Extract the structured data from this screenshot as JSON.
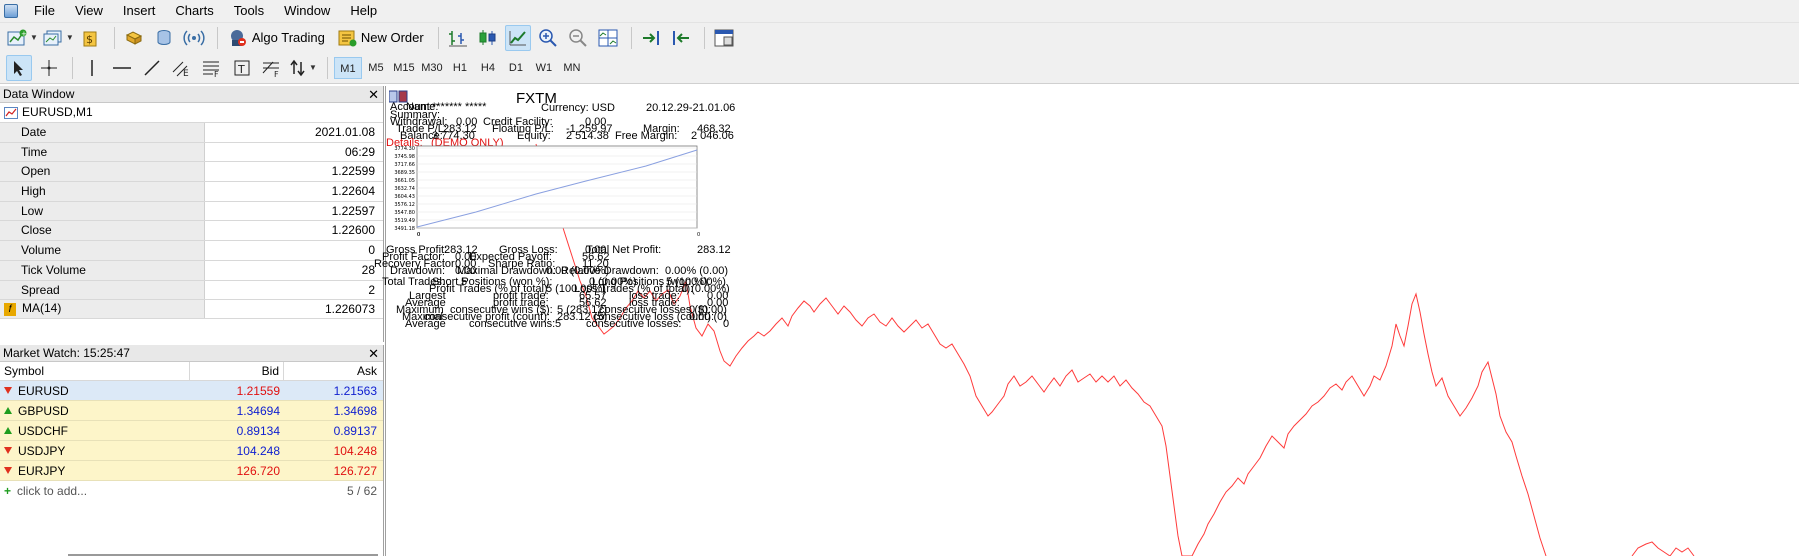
{
  "menu": [
    "File",
    "View",
    "Insert",
    "Charts",
    "Tools",
    "Window",
    "Help"
  ],
  "toolbar": {
    "algo_trading": "Algo Trading",
    "new_order": "New Order"
  },
  "timeframes": [
    "M1",
    "M5",
    "M15",
    "M30",
    "H1",
    "H4",
    "D1",
    "W1",
    "MN"
  ],
  "active_timeframe": "M1",
  "data_window": {
    "title": "Data Window",
    "symbol": "EURUSD,M1",
    "rows": [
      {
        "name": "Date",
        "value": "2021.01.08"
      },
      {
        "name": "Time",
        "value": "06:29"
      },
      {
        "name": "Open",
        "value": "1.22599"
      },
      {
        "name": "High",
        "value": "1.22604"
      },
      {
        "name": "Low",
        "value": "1.22597"
      },
      {
        "name": "Close",
        "value": "1.22600"
      },
      {
        "name": "Volume",
        "value": "0"
      },
      {
        "name": "Tick Volume",
        "value": "28"
      },
      {
        "name": "Spread",
        "value": "2"
      }
    ],
    "indicator": {
      "name": "MA(14)",
      "value": "1.226073"
    }
  },
  "market_watch": {
    "title": "Market Watch: 15:25:47",
    "columns": [
      "Symbol",
      "Bid",
      "Ask"
    ],
    "rows": [
      {
        "symbol": "EURUSD",
        "bid": "1.21559",
        "ask": "1.21563",
        "dir": "down",
        "bid_color": "red",
        "ask_color": "blue"
      },
      {
        "symbol": "GBPUSD",
        "bid": "1.34694",
        "ask": "1.34698",
        "dir": "up",
        "bid_color": "blue",
        "ask_color": "blue"
      },
      {
        "symbol": "USDCHF",
        "bid": "0.89134",
        "ask": "0.89137",
        "dir": "up",
        "bid_color": "blue",
        "ask_color": "blue"
      },
      {
        "symbol": "USDJPY",
        "bid": "104.248",
        "ask": "104.248",
        "dir": "down",
        "bid_color": "blue",
        "ask_color": "red"
      },
      {
        "symbol": "EURJPY",
        "bid": "126.720",
        "ask": "126.727",
        "dir": "down",
        "bid_color": "red",
        "ask_color": "red"
      }
    ],
    "add_label": "click to add...",
    "count": "5 / 62"
  },
  "report": {
    "broker": "FXTM",
    "account_label": "Account:",
    "account_value": "******* *****",
    "currency": "Currency: USD",
    "period": "20.12.29-21.01.06",
    "name_label": "Name:",
    "summary_label": "Summary:",
    "withdrawal_label": "Withdrawal:",
    "withdrawal_value": "0.00",
    "credit_label": "Credit Facility:",
    "credit_value": "0.00",
    "tradepl_label": "Trade P/L:",
    "tradepl_value": "283.12",
    "floating_label": "Floating P/L:",
    "floating_value": "-1 259.97",
    "margin_label": "Margin:",
    "margin_value": "468.32",
    "balance_label": "Balance:",
    "balance_value": "3 774.30",
    "equity_label": "Equity:",
    "equity_value": "2 514.38",
    "free_margin_label": "Free Margin:",
    "free_margin_value": "2 046.06",
    "demo_label": "Details:",
    "demo_note": "(DEMO ONLY)",
    "y_ticks": [
      "3774.30",
      "3745.98",
      "3717.66",
      "3689.35",
      "3661.05",
      "3632.74",
      "3604.43",
      "3576.12",
      "3547.80",
      "3519.49",
      "3491.18"
    ],
    "x_ticks": [
      "0",
      "0",
      "0"
    ],
    "stats": {
      "gross_profit_label": "Gross Profit:",
      "gross_profit": "283.12",
      "gross_loss_label": "Gross Loss:",
      "gross_loss": "0.00",
      "total_net_label": "Total Net Profit:",
      "total_net": "283.12",
      "profit_factor_label": "Profit Factor:",
      "profit_factor": "0.00",
      "expected_payoff_label": "Expected Payoff:",
      "expected_payoff": "56.62",
      "recovery_label": "Recovery Factor:",
      "recovery": "0.00",
      "sharpe_label": "Sharpe Ratio:",
      "sharpe": "11.20",
      "drawdown_label": "Drawdown:",
      "drawdown": "0.00",
      "maximal_dd_label": "Maximal Drawdown:",
      "maximal_dd": "0.00 (0.00%)",
      "relative_dd_label": "Relative Drawdown:",
      "relative_dd": "0.00% (0.00)",
      "total_trades_label": "Total Trades:",
      "total_trades": "5",
      "short_label": "Short Positions (won %):",
      "short": "0 (0.00%)",
      "long_label": "Long Positions (won %):",
      "long": "5 (100.00%)",
      "profit_trades_label": "Profit Trades (% of total):",
      "profit_trades": "5 (100.00%)",
      "loss_trades_label": "Loss Trades (% of total):",
      "loss_trades": "0 (0.00%)",
      "largest_label": "Largest",
      "profit_trade_label": "profit trade:",
      "largest_profit": "65.57",
      "loss_trade_label": "loss trade:",
      "largest_loss": "0.00",
      "average_label": "Average",
      "average_profit": "56.62",
      "average_loss": "0.00",
      "maximum_label": "Maximum",
      "consec_wins_label": "consecutive wins ($):",
      "consec_wins": "5 (283.12)",
      "consec_losses_label": "consecutive losses ($):",
      "consec_losses": "0 (0.00)",
      "maximal_label": "Maximal",
      "consec_profit_label": "consecutive profit (count):",
      "consec_profit": "283.12 (5)",
      "consec_loss_label": "consecutive loss (count):",
      "consec_loss": "0.00 (0)",
      "average2_label": "Average",
      "avg_consec_wins_label": "consecutive wins:",
      "avg_consec_wins": "5",
      "avg_consec_losses_label": "consecutive losses:",
      "avg_consec_losses": "0"
    }
  },
  "colors": {
    "price_line": "#ff3b3b",
    "balance_line": "#8aa0e0"
  }
}
